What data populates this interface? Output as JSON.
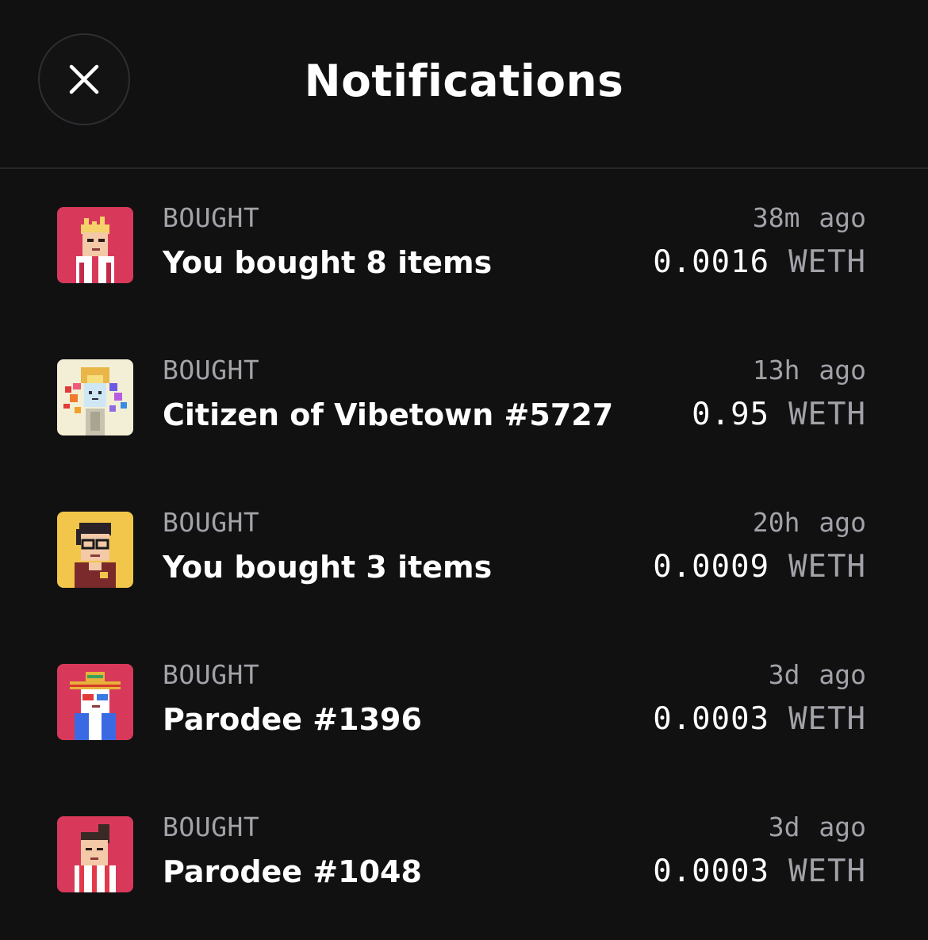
{
  "header": {
    "title": "Notifications",
    "close_icon": "close-icon"
  },
  "colors": {
    "background": "#111112",
    "text_primary": "#ffffff",
    "text_secondary": "#a2a2a8",
    "divider": "#26262b"
  },
  "notifications": [
    {
      "type": "BOUGHT",
      "title": "You bought 8 items",
      "time": "38m ago",
      "amount": "0.0016",
      "currency": "WETH",
      "avatar": "pixel-avatar-pink-horned",
      "avatar_bg": "#d8395a"
    },
    {
      "type": "BOUGHT",
      "title": "Citizen of Vibetown #5727",
      "time": "13h ago",
      "amount": "0.95",
      "currency": "WETH",
      "avatar": "citizen-of-vibetown-art",
      "avatar_bg": "#f3efd6"
    },
    {
      "type": "BOUGHT",
      "title": "You bought 3 items",
      "time": "20h ago",
      "amount": "0.0009",
      "currency": "WETH",
      "avatar": "pixel-avatar-glasses",
      "avatar_bg": "#f1c64a"
    },
    {
      "type": "BOUGHT",
      "title": "Parodee #1396",
      "time": "3d ago",
      "amount": "0.0003",
      "currency": "WETH",
      "avatar": "pixel-avatar-sombrero",
      "avatar_bg": "#d8395a"
    },
    {
      "type": "BOUGHT",
      "title": "Parodee #1048",
      "time": "3d ago",
      "amount": "0.0003",
      "currency": "WETH",
      "avatar": "pixel-avatar-ponytail",
      "avatar_bg": "#d8395a"
    }
  ]
}
